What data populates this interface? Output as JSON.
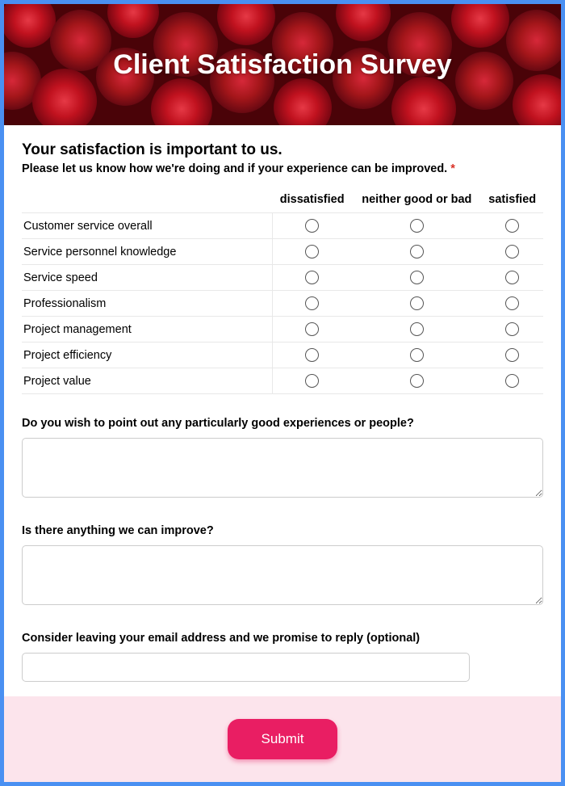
{
  "header": {
    "title": "Client Satisfaction Survey"
  },
  "intro": {
    "heading": "Your satisfaction is important to us.",
    "subheading": "Please let us know how we're doing and if your experience can be improved.",
    "required_marker": "*"
  },
  "matrix": {
    "columns": [
      "dissatisfied",
      "neither good or bad",
      "satisfied"
    ],
    "rows": [
      "Customer service overall",
      "Service personnel knowledge",
      "Service speed",
      "Professionalism",
      "Project management",
      "Project efficiency",
      "Project value"
    ]
  },
  "q_good": {
    "label": "Do you wish to point out any particularly good experiences or people?",
    "value": ""
  },
  "q_improve": {
    "label": "Is there anything we can improve?",
    "value": ""
  },
  "q_email": {
    "label": "Consider leaving your email address and we promise to reply (optional)",
    "value": ""
  },
  "submit": {
    "label": "Submit"
  },
  "colors": {
    "accent": "#e91e63",
    "border": "#4a90f2",
    "footer_bg": "#fce4ec"
  }
}
